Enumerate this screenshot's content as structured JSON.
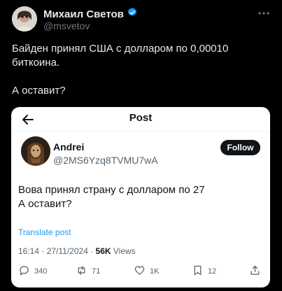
{
  "author": {
    "name": "Михаил Светов",
    "handle": "@msvetov"
  },
  "tweet": {
    "paragraphs": [
      "Байден принял США с долларом по 0,00010 биткоина.",
      "А оставит?"
    ]
  },
  "embed": {
    "header_title": "Post",
    "author": {
      "name": "Andrei",
      "handle": "@2MS6Yzq8TVMU7wA"
    },
    "follow_label": "Follow",
    "text_lines": [
      "Вова принял страну с долларом по 27",
      "А оставит?"
    ],
    "translate_label": "Translate post",
    "time": "16:14 · 27/11/2024 · ",
    "views_count": "56K",
    "views_label": " Views",
    "actions": {
      "replies": "340",
      "reposts": "71",
      "likes": "1K",
      "bookmarks": "12"
    }
  },
  "colors": {
    "background": "#000000",
    "text": "#e7e9ea",
    "muted": "#71767b",
    "link": "#1d9bf0",
    "verified": "#1d9bf0"
  },
  "icons": [
    "verified-badge-icon",
    "more-icon",
    "back-arrow-icon",
    "reply-icon",
    "repost-icon",
    "like-icon",
    "bookmark-icon",
    "share-icon"
  ]
}
